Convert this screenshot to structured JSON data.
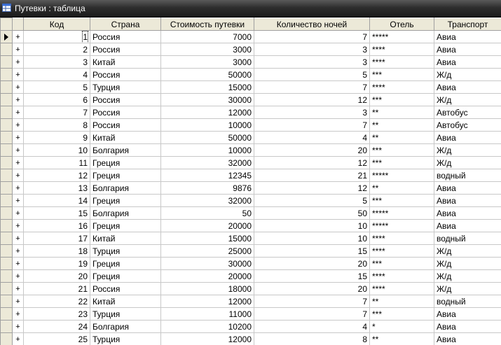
{
  "window": {
    "title": "Путевки : таблица"
  },
  "icons": {
    "table": "table-icon",
    "current_row": "current-record-arrow-icon",
    "expand": "plus-expand-icon"
  },
  "columns": [
    "Код",
    "Страна",
    "Стоимость путевки",
    "Количество ночей",
    "Отель",
    "Транспорт"
  ],
  "expand_symbol": "+",
  "current_row_index": 0,
  "rows": [
    {
      "kod": "1",
      "country": "Россия",
      "cost": "7000",
      "nights": "7",
      "hotel": "*****",
      "transport": "Авиа"
    },
    {
      "kod": "2",
      "country": "Россия",
      "cost": "3000",
      "nights": "3",
      "hotel": "****",
      "transport": "Авиа"
    },
    {
      "kod": "3",
      "country": "Китай",
      "cost": "3000",
      "nights": "3",
      "hotel": "****",
      "transport": "Авиа"
    },
    {
      "kod": "4",
      "country": "Россия",
      "cost": "50000",
      "nights": "5",
      "hotel": "***",
      "transport": "Ж/д"
    },
    {
      "kod": "5",
      "country": "Турция",
      "cost": "15000",
      "nights": "7",
      "hotel": "****",
      "transport": "Авиа"
    },
    {
      "kod": "6",
      "country": "Россия",
      "cost": "30000",
      "nights": "12",
      "hotel": "***",
      "transport": "Ж/д"
    },
    {
      "kod": "7",
      "country": "Россия",
      "cost": "12000",
      "nights": "3",
      "hotel": "**",
      "transport": "Автобус"
    },
    {
      "kod": "8",
      "country": "Россия",
      "cost": "10000",
      "nights": "7",
      "hotel": "**",
      "transport": "Автобус"
    },
    {
      "kod": "9",
      "country": "Китай",
      "cost": "50000",
      "nights": "4",
      "hotel": "**",
      "transport": "Авиа"
    },
    {
      "kod": "10",
      "country": "Болгария",
      "cost": "10000",
      "nights": "20",
      "hotel": "***",
      "transport": "Ж/д"
    },
    {
      "kod": "11",
      "country": "Греция",
      "cost": "32000",
      "nights": "12",
      "hotel": "***",
      "transport": "Ж/д"
    },
    {
      "kod": "12",
      "country": "Греция",
      "cost": "12345",
      "nights": "21",
      "hotel": "*****",
      "transport": "водный"
    },
    {
      "kod": "13",
      "country": "Болгария",
      "cost": "9876",
      "nights": "12",
      "hotel": "**",
      "transport": "Авиа"
    },
    {
      "kod": "14",
      "country": "Греция",
      "cost": "32000",
      "nights": "5",
      "hotel": "***",
      "transport": "Авиа"
    },
    {
      "kod": "15",
      "country": "Болгария",
      "cost": "50",
      "nights": "50",
      "hotel": "*****",
      "transport": "Авиа"
    },
    {
      "kod": "16",
      "country": "Греция",
      "cost": "20000",
      "nights": "10",
      "hotel": "*****",
      "transport": "Авиа"
    },
    {
      "kod": "17",
      "country": "Китай",
      "cost": "15000",
      "nights": "10",
      "hotel": "****",
      "transport": "водный"
    },
    {
      "kod": "18",
      "country": "Турция",
      "cost": "25000",
      "nights": "15",
      "hotel": "****",
      "transport": "Ж/д"
    },
    {
      "kod": "19",
      "country": "Греция",
      "cost": "30000",
      "nights": "20",
      "hotel": "***",
      "transport": "Ж/д"
    },
    {
      "kod": "20",
      "country": "Греция",
      "cost": "20000",
      "nights": "15",
      "hotel": "****",
      "transport": "Ж/д"
    },
    {
      "kod": "21",
      "country": "Россия",
      "cost": "18000",
      "nights": "20",
      "hotel": "****",
      "transport": "Ж/д"
    },
    {
      "kod": "22",
      "country": "Китай",
      "cost": "12000",
      "nights": "7",
      "hotel": "**",
      "transport": "водный"
    },
    {
      "kod": "23",
      "country": "Турция",
      "cost": "11000",
      "nights": "7",
      "hotel": "***",
      "transport": "Авиа"
    },
    {
      "kod": "24",
      "country": "Болгария",
      "cost": "10200",
      "nights": "4",
      "hotel": "*",
      "transport": "Авиа"
    },
    {
      "kod": "25",
      "country": "Турция",
      "cost": "12000",
      "nights": "8",
      "hotel": "**",
      "transport": "Авиа"
    }
  ]
}
